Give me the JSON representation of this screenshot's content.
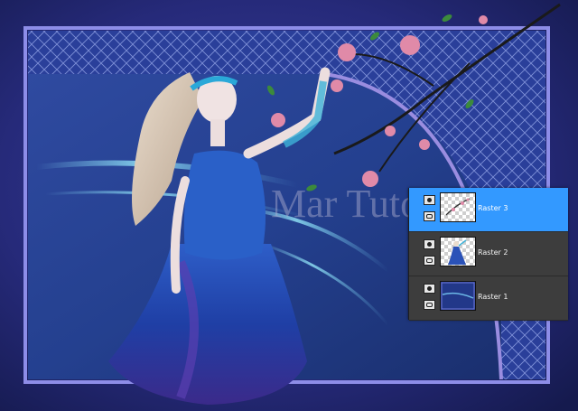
{
  "artwork": {
    "watermark_text": "Mar Tutorial"
  },
  "layers_panel": {
    "layers": [
      {
        "name": "Raster 3",
        "selected": true,
        "thumbnail": "flower-branch"
      },
      {
        "name": "Raster 2",
        "selected": false,
        "thumbnail": "woman-figure"
      },
      {
        "name": "Raster 1",
        "selected": false,
        "thumbnail": "blue-background"
      }
    ]
  },
  "colors": {
    "selection": "#3399ff",
    "panel": "#3d3d3d",
    "frame": "#8d8de8",
    "background": "#1b2160"
  }
}
